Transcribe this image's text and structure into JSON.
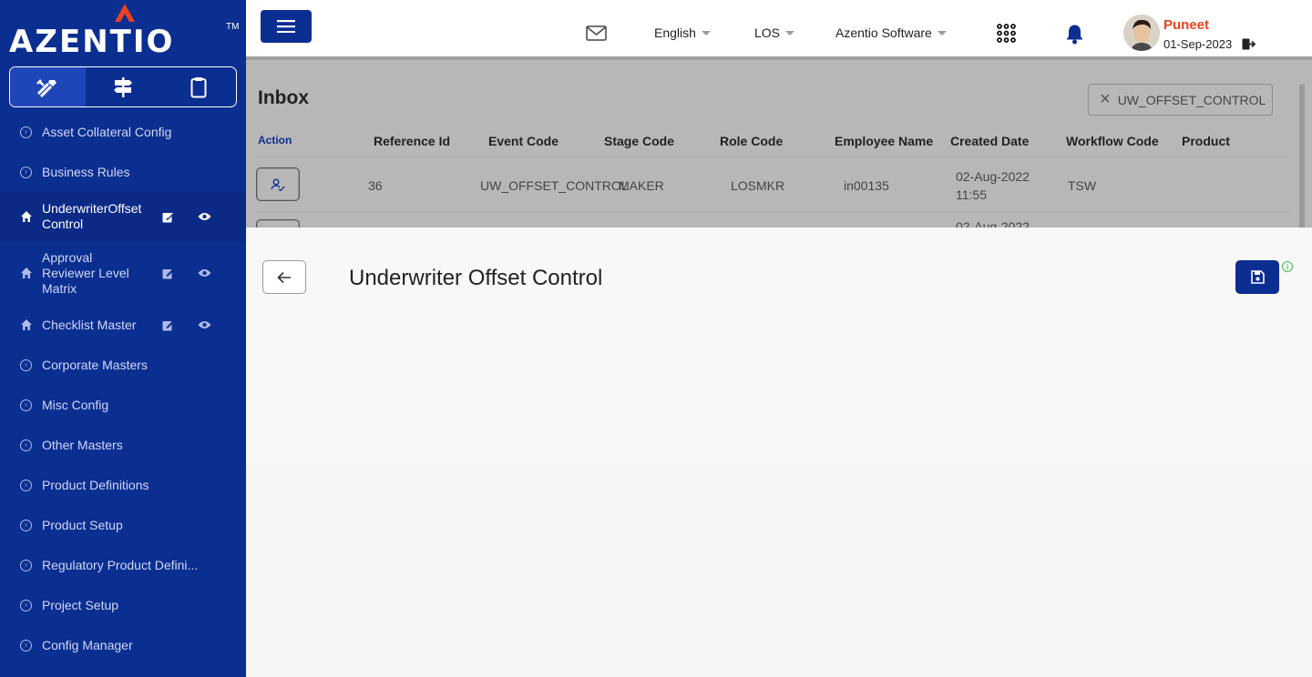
{
  "brand": {
    "logo_text": "AZENTIO",
    "tm": "TM"
  },
  "sidebar": {
    "items": [
      {
        "label": "Asset Collateral Config"
      },
      {
        "label": "Business Rules"
      },
      {
        "label": "UnderwriterOffsetControl"
      },
      {
        "label": "Approval Reviewer Level Matrix"
      },
      {
        "label": "Checklist Master"
      },
      {
        "label": "Corporate Masters"
      },
      {
        "label": "Misc Config"
      },
      {
        "label": "Other Masters"
      },
      {
        "label": "Product Definitions"
      },
      {
        "label": "Product Setup"
      },
      {
        "label": "Regulatory Product Defini..."
      },
      {
        "label": "Project Setup"
      },
      {
        "label": "Config Manager"
      }
    ]
  },
  "header": {
    "language": "English",
    "module": "LOS",
    "company": "Azentio Software",
    "user_name": "Puneet",
    "user_date": "01-Sep-2023"
  },
  "inbox": {
    "title": "Inbox",
    "filter_chip": "UW_OFFSET_CONTROL",
    "columns": [
      "Action",
      "Reference Id",
      "Event Code",
      "Stage Code",
      "Role Code",
      "Employee Name",
      "Created Date",
      "Workflow Code",
      "Product"
    ],
    "rows": [
      {
        "reference_id": "36",
        "event_code": "UW_OFFSET_CONTROL",
        "stage_code": "MAKER",
        "role_code": "LOSMKR",
        "employee_name": "in00135",
        "created_date": "02-Aug-2022",
        "created_time": "11:55",
        "workflow_code": "TSW",
        "product": ""
      },
      {
        "created_date": "02-Aug-2022"
      }
    ]
  },
  "panel": {
    "title": "Underwriter Offset Control"
  }
}
